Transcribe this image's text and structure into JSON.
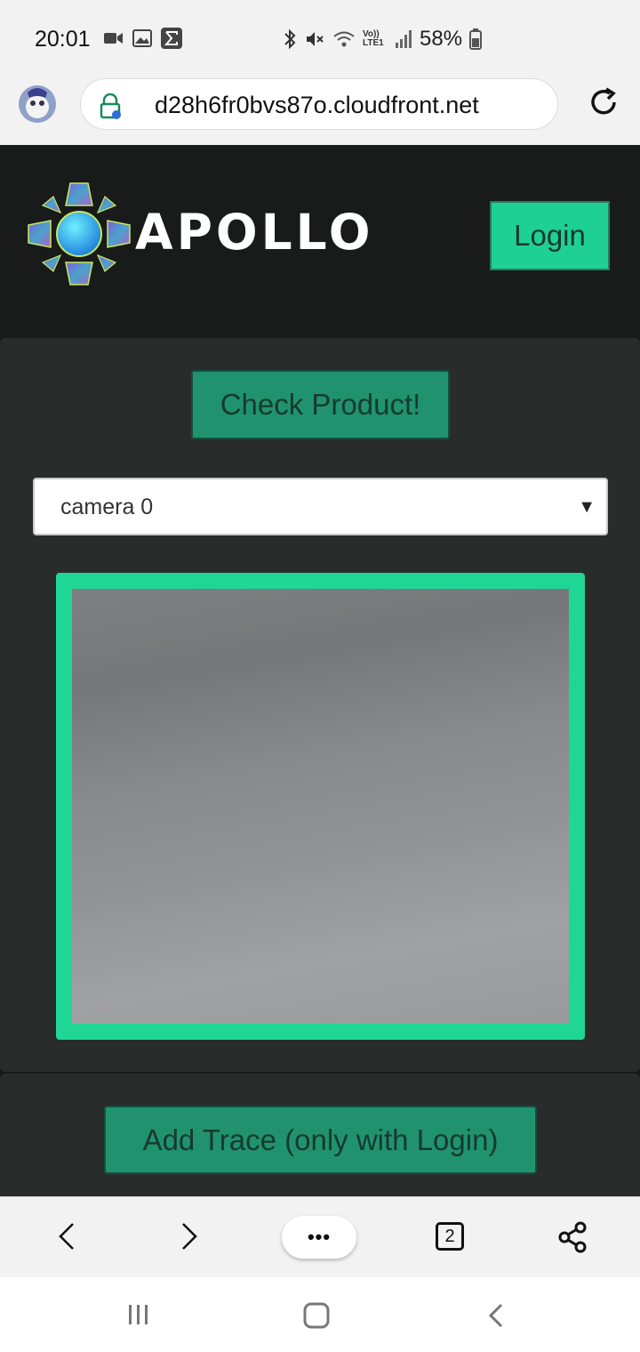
{
  "status_bar": {
    "time": "20:01",
    "battery": "58%",
    "network_label": "Vo)) LTE1",
    "icons": [
      "video-icon",
      "image-icon",
      "sigma-icon",
      "bluetooth-icon",
      "mute-icon",
      "wifi-icon",
      "signal-icon",
      "battery-icon"
    ]
  },
  "browser": {
    "url": "d28h6fr0bvs87o.cloudfront.net",
    "tab_count": "2",
    "menu_label": "•••"
  },
  "header": {
    "brand": "APOLLO",
    "login_label": "Login"
  },
  "main": {
    "check_label": "Check Product!",
    "camera_select": {
      "value": "camera 0",
      "arrow": "▼"
    },
    "trace_label": "Add Trace (only with Login)"
  },
  "colors": {
    "accent": "#1fd695",
    "button": "#20936e",
    "page_bg": "#181b1a",
    "card_bg": "#282c2b"
  }
}
